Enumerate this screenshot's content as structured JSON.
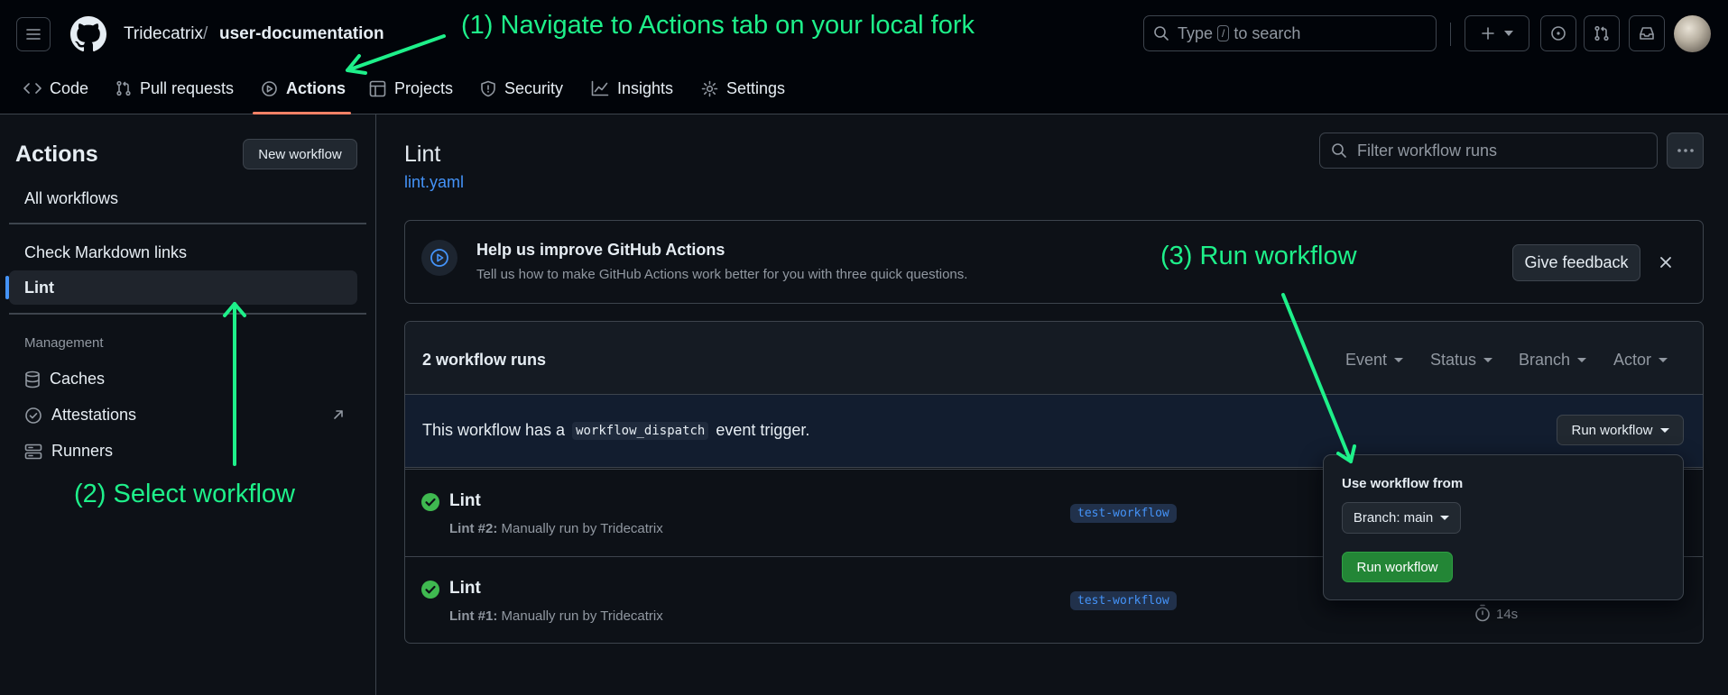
{
  "colors": {
    "accent_tab": "#f78166",
    "link": "#4493f8",
    "success": "#3fb950",
    "annotation": "#1ef08a",
    "primary_button": "#238636"
  },
  "header": {
    "owner": "Tridecatrix",
    "separator": "/",
    "repo": "user-documentation",
    "search_prefix": "Type",
    "search_key": "/",
    "search_suffix": "to search",
    "tabs": [
      {
        "label": "Code",
        "icon": "code-icon"
      },
      {
        "label": "Pull requests",
        "icon": "pull-request-icon"
      },
      {
        "label": "Actions",
        "icon": "play-icon",
        "active": true
      },
      {
        "label": "Projects",
        "icon": "table-icon"
      },
      {
        "label": "Security",
        "icon": "shield-icon"
      },
      {
        "label": "Insights",
        "icon": "graph-icon"
      },
      {
        "label": "Settings",
        "icon": "gear-icon"
      }
    ]
  },
  "sidebar": {
    "title": "Actions",
    "new_workflow": "New workflow",
    "all_workflows": "All workflows",
    "workflows": [
      "Check Markdown links",
      "Lint"
    ],
    "management_heading": "Management",
    "management_items": [
      "Caches",
      "Attestations",
      "Runners"
    ]
  },
  "main": {
    "title": "Lint",
    "file_link": "lint.yaml",
    "filter_placeholder": "Filter workflow runs",
    "banner": {
      "title": "Help us improve GitHub Actions",
      "subtitle": "Tell us how to make GitHub Actions work better for you with three quick questions.",
      "feedback_button": "Give feedback"
    },
    "runs_count": "2 workflow runs",
    "filters": [
      "Event",
      "Status",
      "Branch",
      "Actor"
    ],
    "dispatch_prefix": "This workflow has a",
    "dispatch_code": "workflow_dispatch",
    "dispatch_suffix": "event trigger.",
    "run_workflow_button": "Run workflow",
    "runs": [
      {
        "name": "Lint",
        "meta_num": "Lint #2:",
        "meta_text": "Manually run by Tridecatrix",
        "branch": "test-workflow",
        "duration": ""
      },
      {
        "name": "Lint",
        "meta_num": "Lint #1:",
        "meta_text": "Manually run by Tridecatrix",
        "branch": "test-workflow",
        "duration": "14s"
      }
    ],
    "dropdown": {
      "label": "Use workflow from",
      "branch_select": "Branch: main",
      "run_button": "Run workflow"
    }
  },
  "annotations": {
    "step1": "(1) Navigate to Actions tab on your local fork",
    "step2": "(2) Select workflow",
    "step3": "(3) Run workflow"
  }
}
